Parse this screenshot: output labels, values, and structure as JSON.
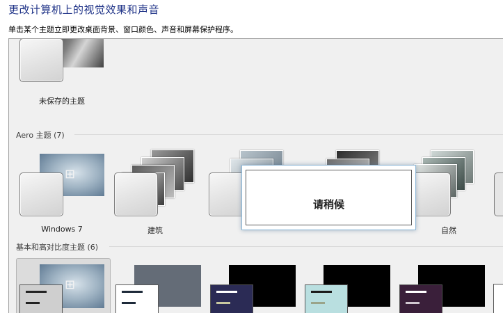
{
  "page": {
    "title": "更改计算机上的视觉效果和声音",
    "description": "单击某个主题立即更改桌面背景、窗口颜色、声音和屏幕保护程序。"
  },
  "my_themes": {
    "items": [
      {
        "label": "未保存的主题"
      }
    ]
  },
  "aero_section": {
    "header": "Aero 主题 (7)",
    "items": [
      {
        "label": "Windows 7"
      },
      {
        "label": "建筑"
      },
      {
        "label": ""
      },
      {
        "label": ""
      },
      {
        "label": "自然"
      }
    ]
  },
  "basic_section": {
    "header": "基本和高对比度主题 (6)"
  },
  "wait_dialog": {
    "text": "请稍候"
  },
  "colors": {
    "title_text": "#1e3287",
    "panel_bg": "#f0f0f0",
    "dialog_border": "#8eb8d7"
  }
}
